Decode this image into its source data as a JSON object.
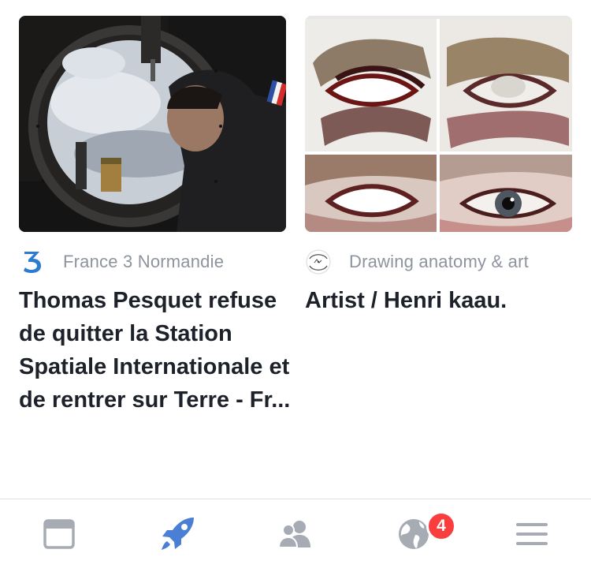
{
  "cards": [
    {
      "image": "astronaut-window-photo",
      "source": "France 3 Normandie",
      "source_logo": "france3-logo-icon",
      "headline": "Thomas Pesquet refuse de quitter la Station Spatiale Internationale et de rentrer sur Terre - Fr..."
    },
    {
      "image": "eye-painting-studies",
      "source": "Drawing anatomy & art",
      "source_logo": "drawing-anatomy-logo-icon",
      "headline": "Artist / Henri kaau."
    }
  ],
  "tabbar": {
    "tabs": [
      {
        "name": "news-feed",
        "icon": "news-feed-icon",
        "active": false
      },
      {
        "name": "explore",
        "icon": "rocket-icon",
        "active": true
      },
      {
        "name": "friends",
        "icon": "friends-icon",
        "active": false
      },
      {
        "name": "notifications",
        "icon": "globe-icon",
        "active": false,
        "badge": "4"
      },
      {
        "name": "menu",
        "icon": "hamburger-menu-icon",
        "active": false
      }
    ]
  },
  "colors": {
    "active_tab": "#4a7fd4",
    "inactive_tab": "#a7abb3",
    "badge": "#fa3e3e",
    "source_text": "#8d949e",
    "headline_text": "#1d2129"
  }
}
